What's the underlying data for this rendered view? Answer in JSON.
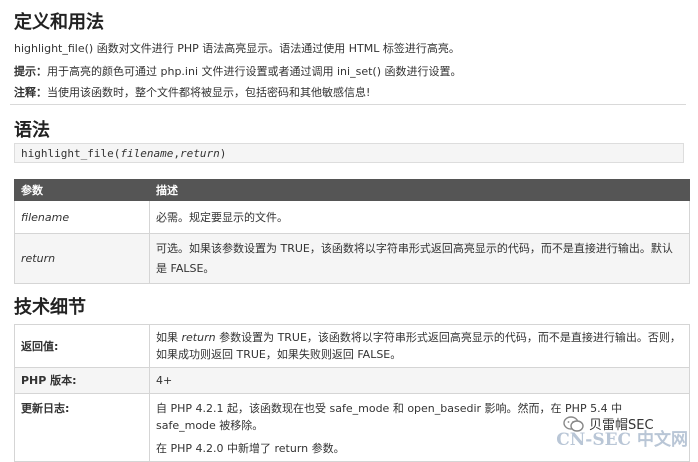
{
  "sections": {
    "usage_title": "定义和用法",
    "syntax_title": "语法",
    "tech_title": "技术细节"
  },
  "usage": {
    "line1": "highlight_file() 函数对文件进行 PHP 语法高亮显示。语法通过使用 HTML 标签进行高亮。",
    "tip_label": "提示：",
    "tip_text": "用于高亮的颜色可通过 php.ini 文件进行设置或者通过调用 ini_set() 函数进行设置。",
    "note_label": "注释：",
    "note_text": "当使用该函数时，整个文件都将被显示，包括密码和其他敏感信息!"
  },
  "syntax": {
    "func": "highlight_file(",
    "arg1": "filename",
    "comma": ",",
    "arg2": "return",
    "close": ")"
  },
  "params": {
    "headers": [
      "参数",
      "描述"
    ],
    "rows": [
      {
        "name": "filename",
        "desc": "必需。规定要显示的文件。"
      },
      {
        "name": "return",
        "desc": "可选。如果该参数设置为 TRUE，该函数将以字符串形式返回高亮显示的代码，而不是直接进行输出。默认是 FALSE。"
      }
    ]
  },
  "tech": {
    "rows": [
      {
        "label": "返回值:",
        "pre": "如果 ",
        "em": "return",
        "post": " 参数设置为 TRUE，该函数将以字符串形式返回高亮显示的代码，而不是直接进行输出。否则，如果成功则返回 TRUE，如果失败则返回 FALSE。"
      },
      {
        "label": "PHP 版本:",
        "value": "4+"
      },
      {
        "label": "更新日志:",
        "line1": "自 PHP 4.2.1 起，该函数现在也受 safe_mode 和 open_basedir 影响。然而，在 PHP 5.4 中 safe_mode 被移除。",
        "line2": "在 PHP 4.2.0 中新增了 return 参数。"
      }
    ]
  },
  "overlay": {
    "wechat_name": "贝雷帽SEC",
    "watermark": "CN-SEC 中文网"
  },
  "colors": {
    "header_bg": "#555555",
    "alt_row_bg": "#f5f5f5",
    "watermark": "#b9c6d6"
  }
}
